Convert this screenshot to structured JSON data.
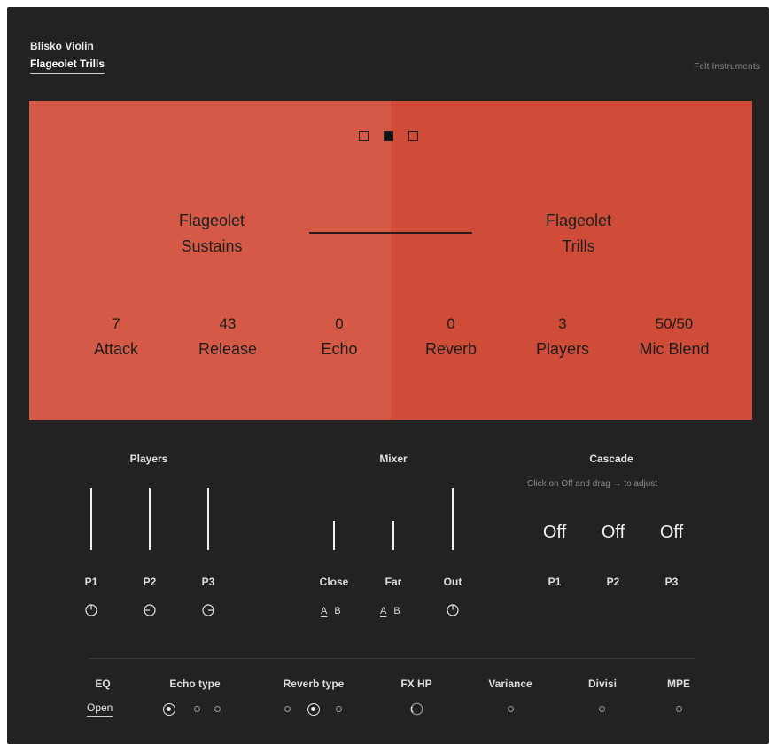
{
  "header": {
    "instrument": "Blisko Violin",
    "preset": "Flageolet Trills",
    "brand": "Felt Instruments"
  },
  "panel": {
    "colors": {
      "left": "#d45a47",
      "right": "#ce4c38",
      "text": "#1d1d1d"
    },
    "pages": {
      "count": 3,
      "active_index": 1
    },
    "articulations": {
      "left": {
        "line1": "Flageolet",
        "line2": "Sustains"
      },
      "right": {
        "line1": "Flageolet",
        "line2": "Trills"
      }
    },
    "params": [
      {
        "value": "7",
        "label": "Attack"
      },
      {
        "value": "43",
        "label": "Release"
      },
      {
        "value": "0",
        "label": "Echo"
      },
      {
        "value": "0",
        "label": "Reverb"
      },
      {
        "value": "3",
        "label": "Players"
      },
      {
        "value": "50/50",
        "label": "Mic Blend"
      }
    ]
  },
  "players": {
    "title": "Players",
    "channels": [
      {
        "label": "P1",
        "level": 1.0,
        "knob": "power-icon"
      },
      {
        "label": "P2",
        "level": 1.0,
        "knob": "pan-left-icon"
      },
      {
        "label": "P3",
        "level": 1.0,
        "knob": "pan-right-icon"
      }
    ]
  },
  "mixer": {
    "title": "Mixer",
    "close": {
      "label": "Close",
      "level": 0.45,
      "a": "A",
      "b": "B",
      "selected": "A"
    },
    "far": {
      "label": "Far",
      "level": 0.45,
      "a": "A",
      "b": "B",
      "selected": "A"
    },
    "out": {
      "label": "Out",
      "level": 1.0,
      "knob": "power-icon"
    }
  },
  "cascade": {
    "title": "Cascade",
    "hint": "Click on Off and drag → to adjust",
    "items": [
      {
        "label": "P1",
        "value": "Off"
      },
      {
        "label": "P2",
        "value": "Off"
      },
      {
        "label": "P3",
        "value": "Off"
      }
    ]
  },
  "bottom": {
    "eq": {
      "label": "EQ",
      "action": "Open"
    },
    "echo_type": {
      "label": "Echo type",
      "options": 3,
      "selected": 0
    },
    "reverb_type": {
      "label": "Reverb type",
      "options": 3,
      "selected": 1
    },
    "fx_hp": {
      "label": "FX HP"
    },
    "variance": {
      "label": "Variance",
      "on": false
    },
    "divisi": {
      "label": "Divisi",
      "on": false
    },
    "mpe": {
      "label": "MPE",
      "on": false
    }
  }
}
